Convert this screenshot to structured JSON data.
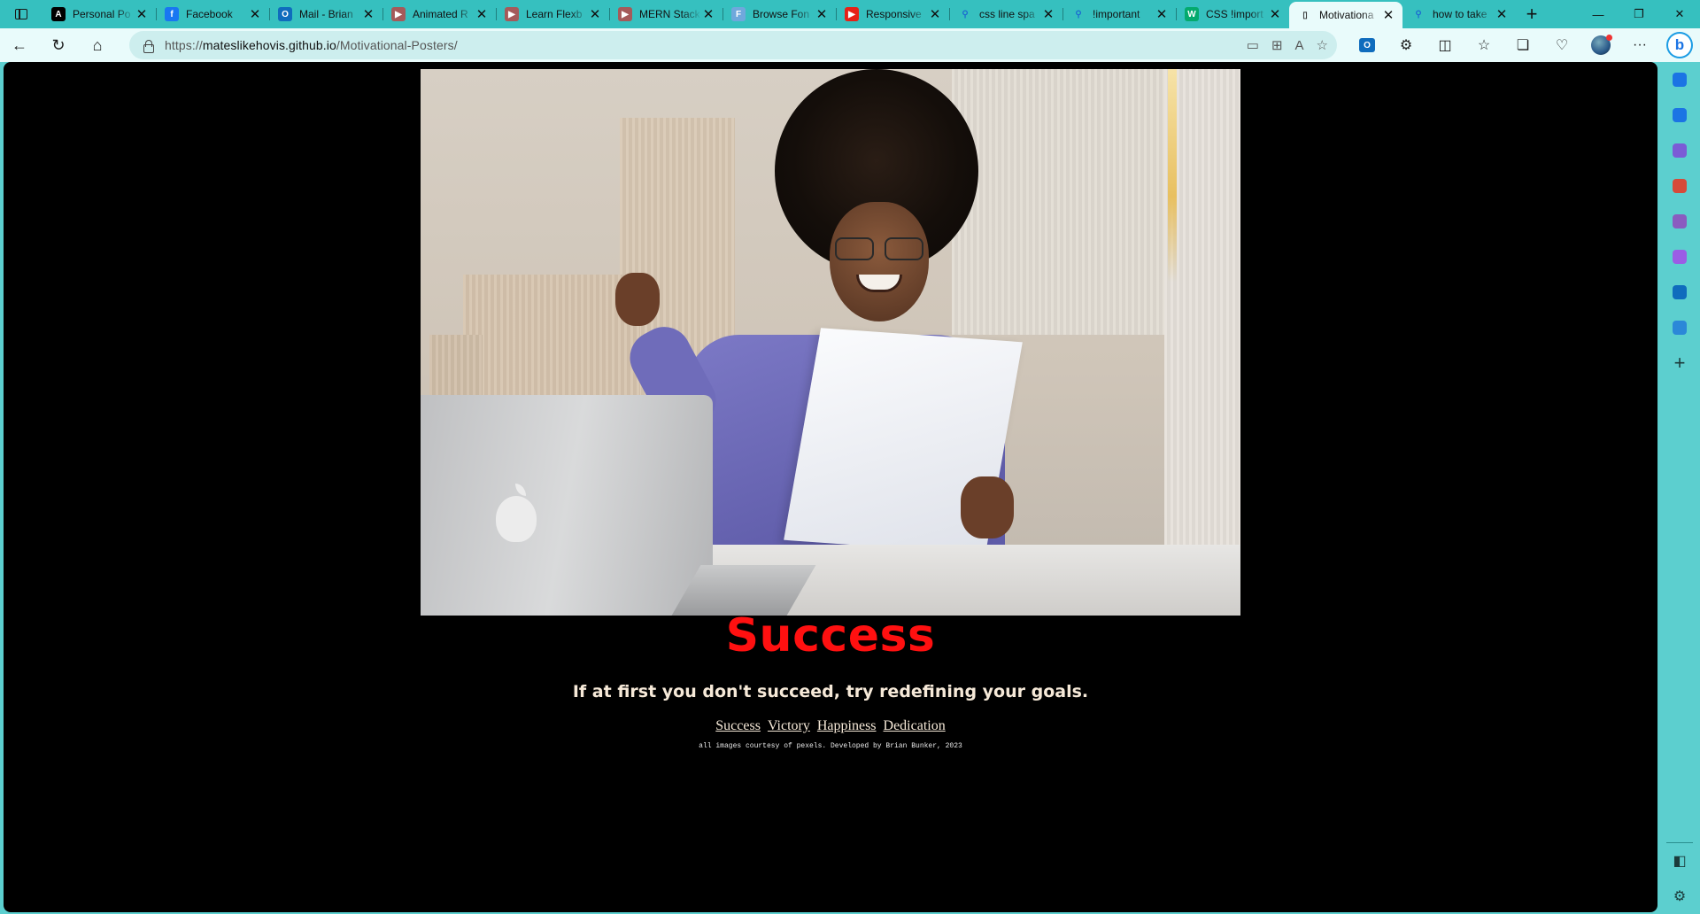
{
  "browser": {
    "tabs": [
      {
        "title": "Personal Po",
        "icon": "codepen-icon",
        "color": "#000000",
        "glyph": "A"
      },
      {
        "title": "Facebook",
        "icon": "facebook-icon",
        "color": "#1877f2",
        "glyph": "f"
      },
      {
        "title": "Mail - Brian",
        "icon": "outlook-icon",
        "color": "#0f6cbd",
        "glyph": "O"
      },
      {
        "title": "Animated R",
        "icon": "youtube-icon",
        "color": "#a55a5a",
        "glyph": "▶"
      },
      {
        "title": "Learn Flexb",
        "icon": "youtube-icon",
        "color": "#a55a5a",
        "glyph": "▶"
      },
      {
        "title": "MERN Stack",
        "icon": "youtube-icon",
        "color": "#a55a5a",
        "glyph": "▶"
      },
      {
        "title": "Browse Fon",
        "icon": "google-fonts-icon",
        "color": "#6fa8dc",
        "glyph": "F"
      },
      {
        "title": "Responsive",
        "icon": "youtube-icon",
        "color": "#e62117",
        "glyph": "▶"
      },
      {
        "title": "css line spa",
        "icon": "search-icon",
        "color": "#36c0bf",
        "glyph": "⚲"
      },
      {
        "title": "!important",
        "icon": "search-icon",
        "color": "#36c0bf",
        "glyph": "⚲"
      },
      {
        "title": "CSS !import",
        "icon": "w3schools-icon",
        "color": "#04aa6d",
        "glyph": "W"
      },
      {
        "title": "Motivationa",
        "icon": "page-icon",
        "color": "#e9fbfb",
        "glyph": "▯"
      },
      {
        "title": "how to take",
        "icon": "search-icon",
        "color": "#36c0bf",
        "glyph": "⚲"
      }
    ],
    "active_tab_index": 11,
    "tab_close_glyph": "✕",
    "new_tab_glyph": "+",
    "url_scheme": "https://",
    "url_host": "mateslikehovis.github.io",
    "url_path": "/Motivational-Posters/",
    "window_controls": {
      "minimize": "—",
      "restore": "❐",
      "close": "✕"
    }
  },
  "page": {
    "headline": "Success",
    "quote": "If at first you don't succeed, try redefining your goals.",
    "nav_links": [
      "Success",
      "Victory",
      "Happiness",
      "Dedication"
    ],
    "credits": "all images courtesy of pexels. Developed by Brian Bunker, 2023",
    "headline_color": "#ff1010",
    "background_color": "#000000"
  },
  "sidebar": {
    "icons": [
      {
        "name": "notifications-icon",
        "color": "#1b74e4"
      },
      {
        "name": "search-icon",
        "color": "#1b74e4"
      },
      {
        "name": "shopping-icon",
        "color": "#7b5cd6"
      },
      {
        "name": "tools-icon",
        "color": "#d64a3a"
      },
      {
        "name": "games-icon",
        "color": "#8a5cc0"
      },
      {
        "name": "microsoft-365-icon",
        "color": "#9b5de5"
      },
      {
        "name": "outlook-icon",
        "color": "#0f6cbd"
      },
      {
        "name": "drop-icon",
        "color": "#2b88d8"
      }
    ],
    "add_glyph": "+"
  }
}
